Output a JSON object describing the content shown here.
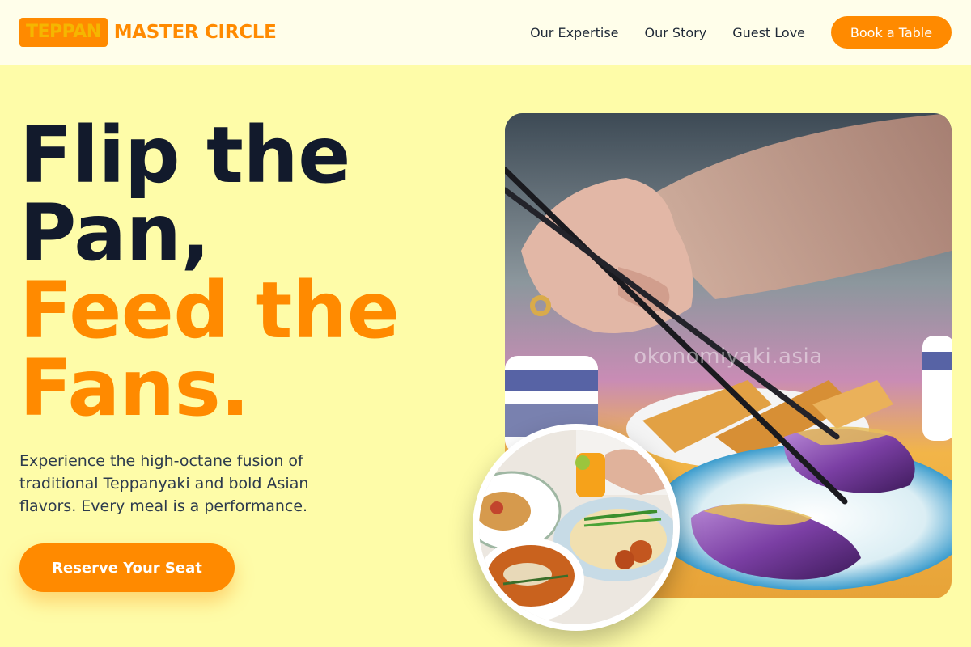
{
  "header": {
    "brand_badge": "TEPPAN",
    "brand_text": "MASTER CIRCLE",
    "nav": [
      "Our Expertise",
      "Our Story",
      "Guest Love"
    ],
    "cta_label": "Book a Table"
  },
  "hero": {
    "title_lines": [
      "Flip the",
      "Pan,"
    ],
    "title_accent_lines": [
      "Feed the",
      "Fans."
    ],
    "description": "Experience the high-octane fusion of traditional Teppanyaki and bold Asian flavors. Every meal is a performance.",
    "button_label": "Reserve Your Seat"
  },
  "images": {
    "main_watermark": "okonomiyaki.asia"
  },
  "colors": {
    "accent": "#ff8a00",
    "background": "#fefca8",
    "header_bg": "#fffeea",
    "title_dark": "#121a2c"
  }
}
